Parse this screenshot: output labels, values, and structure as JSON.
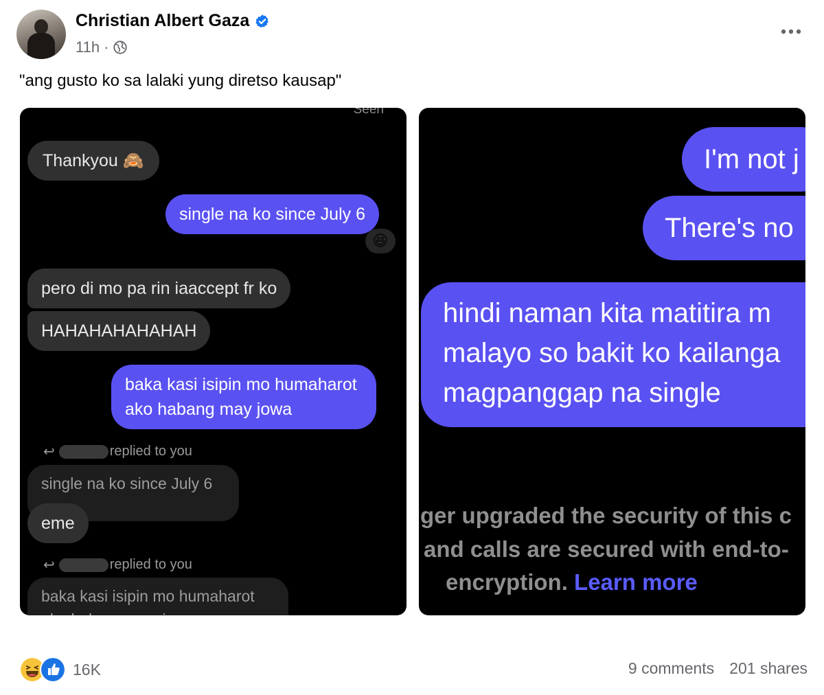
{
  "post": {
    "author": "Christian Albert Gaza",
    "time": "11h",
    "separator": "·",
    "caption": "\"ang gusto ko sa lalaki yung diretso kausap\""
  },
  "left_screenshot": {
    "seen": "Seen",
    "messages": {
      "thankyou": "Thankyou 🙈",
      "single": "single na ko since July 6",
      "reaction": "😆",
      "pero": "pero di mo pa rin iaaccept fr ko",
      "haha": "HAHAHAHAHAHAH",
      "baka_line1": "baka kasi isipin mo humaharot",
      "baka_line2": "ako habang may jowa",
      "replied1": "replied to you",
      "quoted1": "single na ko since July 6",
      "eme": "eme",
      "replied2": "replied to you",
      "quoted2_line1": "baka kasi isipin mo humaharot",
      "quoted2_line2": "ako habang may jowa"
    }
  },
  "right_screenshot": {
    "im_not": "I'm not j",
    "theres_no": "There's no",
    "hindi_line1": "hindi naman kita matitira m",
    "hindi_line2": "malayo so bakit ko kailanga",
    "hindi_line3": "magpanggap na single",
    "sec_line1": "ger upgraded the security of this c",
    "sec_line2": "and calls are secured with end-to-",
    "sec_line3": "encryption.",
    "learn_more": "Learn more"
  },
  "engagement": {
    "reactions": "16K",
    "comments": "9 comments",
    "shares": "201 shares"
  },
  "icons": {
    "verified": "verified-badge-icon",
    "privacy": "globe-icon",
    "more": "more-options-icon",
    "haha_reaction": "haha-reaction-icon",
    "like_reaction": "like-reaction-icon"
  },
  "colors": {
    "accent": "#1877f2",
    "bubble_out": "#5a51f2",
    "bubble_in": "#303030",
    "muted_text": "#65676b"
  }
}
